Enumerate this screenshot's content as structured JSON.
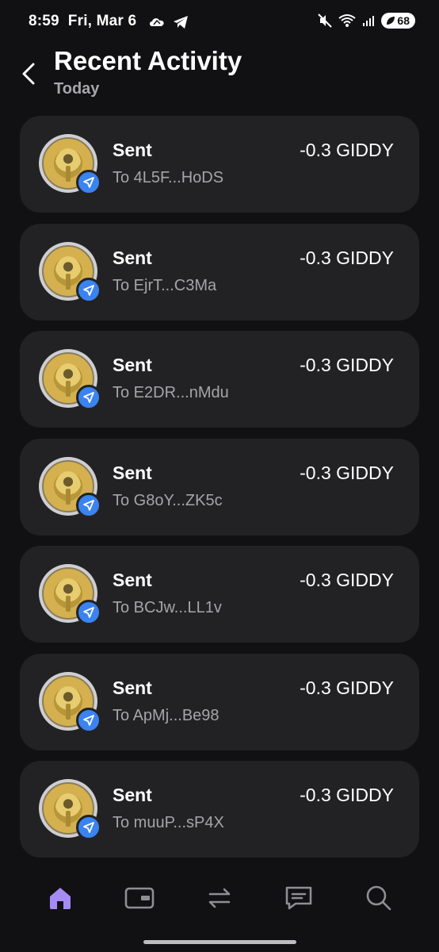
{
  "status_bar": {
    "time": "8:59",
    "date": "Fri, Mar 6",
    "battery": "68"
  },
  "header": {
    "title": "Recent Activity",
    "subtitle": "Today"
  },
  "transactions": [
    {
      "label": "Sent",
      "to": "To 4L5F...HoDS",
      "amount": "-0.3 GIDDY"
    },
    {
      "label": "Sent",
      "to": "To EjrT...C3Ma",
      "amount": "-0.3 GIDDY"
    },
    {
      "label": "Sent",
      "to": "To E2DR...nMdu",
      "amount": "-0.3 GIDDY"
    },
    {
      "label": "Sent",
      "to": "To G8oY...ZK5c",
      "amount": "-0.3 GIDDY"
    },
    {
      "label": "Sent",
      "to": "To BCJw...LL1v",
      "amount": "-0.3 GIDDY"
    },
    {
      "label": "Sent",
      "to": "To ApMj...Be98",
      "amount": "-0.3 GIDDY"
    },
    {
      "label": "Sent",
      "to": "To muuP...sP4X",
      "amount": "-0.3 GIDDY"
    }
  ],
  "nav": {
    "items": [
      "home-icon",
      "wallet-icon",
      "swap-icon",
      "chat-icon",
      "search-icon"
    ],
    "active": "home-icon",
    "active_color": "#a58cf5",
    "inactive_color": "#8e8e93"
  },
  "colors": {
    "background": "#111113",
    "card": "#222224",
    "badge": "#3a83f0"
  }
}
